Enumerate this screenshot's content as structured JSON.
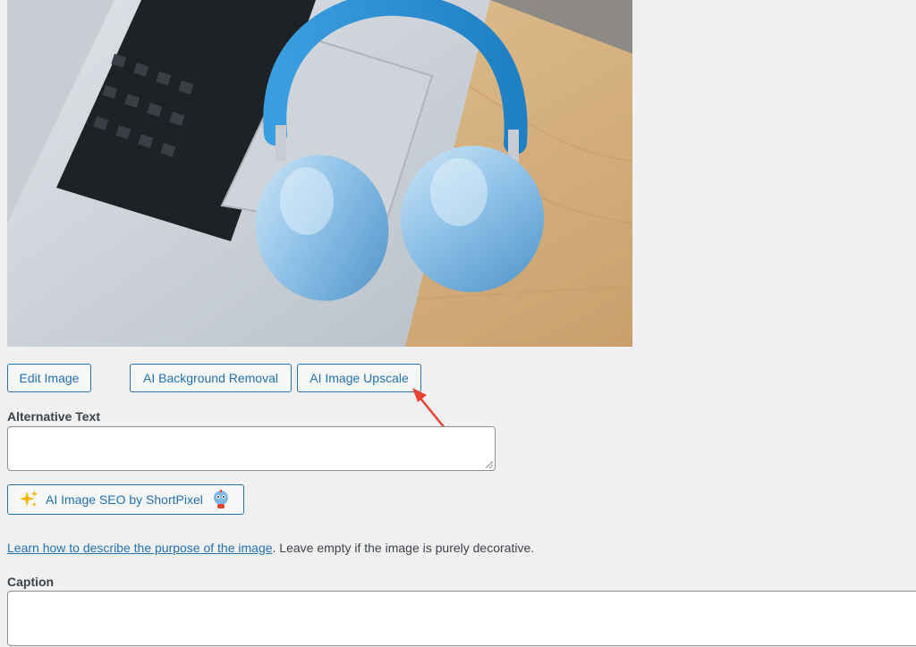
{
  "media": {
    "image_alt": "Blue over-ear headphones on a laptop on a wooden table"
  },
  "buttons": {
    "edit_image": "Edit Image",
    "ai_background_removal": "AI Background Removal",
    "ai_image_upscale": "AI Image Upscale"
  },
  "fields": {
    "alt_text_label": "Alternative Text",
    "alt_text_value": "",
    "caption_label": "Caption",
    "caption_value": ""
  },
  "seo_button": {
    "label": "AI Image SEO by ShortPixel"
  },
  "help": {
    "link_text": "Learn how to describe the purpose of the image",
    "suffix": ". Leave empty if the image is purely decorative."
  },
  "colors": {
    "accent": "#2271b1",
    "annotation_arrow": "#e8432e"
  }
}
